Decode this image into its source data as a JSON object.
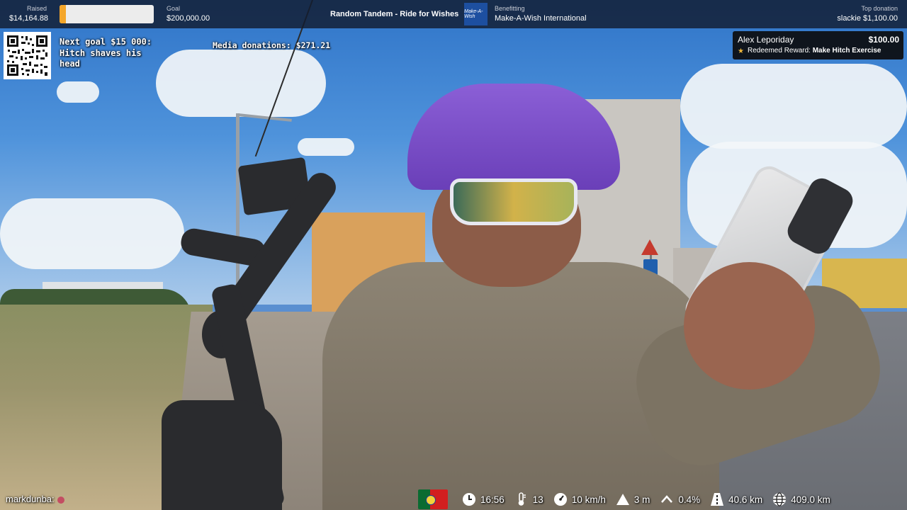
{
  "topbar": {
    "raised_label": "Raised",
    "raised_value": "$14,164.88",
    "progress_fraction": 0.0708,
    "goal_label": "Goal",
    "goal_value": "$200,000.00",
    "campaign_title": "Random Tandem - Ride for Wishes",
    "charity_logo_text": "Make-A-Wish",
    "benefitting_label": "Benefitting",
    "benefitting_value": "Make-A-Wish International",
    "top_donation_label": "Top donation",
    "top_donation_value": "slackie $1,100.00"
  },
  "overlay": {
    "next_goal": "Next goal $15 000: Hitch shaves his head",
    "media_donations": "Media donations: $271.21"
  },
  "alert": {
    "donor": "Alex Leporiday",
    "amount": "$100.00",
    "reward_prefix": "Redeemed Reward:",
    "reward_name": "Make Hitch Exercise",
    "icon": "star-icon"
  },
  "chat": {
    "message": "markdunba:"
  },
  "stats": {
    "flag": "portugal-flag",
    "time": "16:56",
    "temperature": "13",
    "speed": "10 km/h",
    "elevation": "3 m",
    "grade": "0.4%",
    "distance_today": "40.6 km",
    "distance_total": "409.0 km"
  },
  "colors": {
    "progress_fill": "#f4a62a",
    "topbar_bg": "#121c30",
    "star": "#f2b93b"
  }
}
